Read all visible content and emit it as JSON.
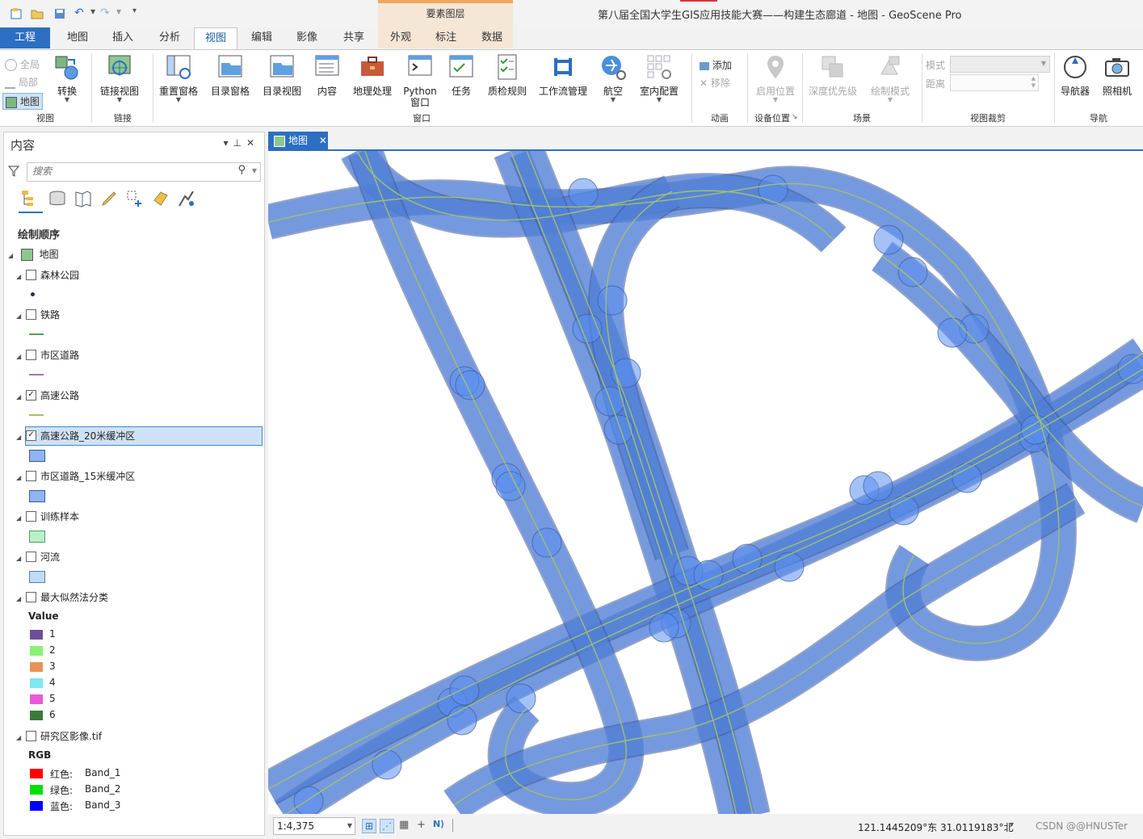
{
  "app": {
    "title": "第八届全国大学生GIS应用技能大赛——构建生态廊道 - 地图 - GeoScene Pro",
    "context_group": "要素图层"
  },
  "tabs": [
    {
      "label": "工程"
    },
    {
      "label": "地图"
    },
    {
      "label": "插入"
    },
    {
      "label": "分析"
    },
    {
      "label": "视图",
      "active": true
    },
    {
      "label": "编辑"
    },
    {
      "label": "影像"
    },
    {
      "label": "共享"
    },
    {
      "label": "外观"
    },
    {
      "label": "标注"
    },
    {
      "label": "数据"
    }
  ],
  "ribbon": {
    "view_group": {
      "label": "视图",
      "global": "全局",
      "local": "局部",
      "map": "地图",
      "convert": "转换"
    },
    "link_group": {
      "label": "链接",
      "link_views": "链接视图"
    },
    "window_group": {
      "label": "窗口",
      "buttons": [
        "重置窗格",
        "目录窗格",
        "目录视图",
        "内容",
        "地理处理",
        "Python 窗口",
        "任务",
        "质检规则",
        "工作流管理",
        "航空",
        "室内配置"
      ]
    },
    "python_line1": "Python",
    "python_line2": "窗口",
    "animation_group": {
      "label": "动画",
      "add": "添加",
      "remove": "移除"
    },
    "device_group": {
      "label": "设备位置",
      "enable": "启用位置"
    },
    "scene_group": {
      "label": "场景",
      "depth": "深度优先级",
      "draw_mode": "绘制模式"
    },
    "clip_group": {
      "label": "视图裁剪",
      "mode": "模式",
      "distance": "距离"
    },
    "nav_group": {
      "label": "导航",
      "navigator": "导航器",
      "camera": "照相机"
    }
  },
  "contents": {
    "title": "内容",
    "search_placeholder": "搜索",
    "drawing_order": "绘制顺序",
    "map_name": "地图",
    "layers": [
      {
        "name": "森林公园",
        "checked": false
      },
      {
        "name": "铁路",
        "checked": false
      },
      {
        "name": "市区道路",
        "checked": false
      },
      {
        "name": "高速公路",
        "checked": true
      },
      {
        "name": "高速公路_20米缓冲区",
        "checked": true,
        "selected": true
      },
      {
        "name": "市区道路_15米缓冲区",
        "checked": false
      },
      {
        "name": "训练样本",
        "checked": false
      },
      {
        "name": "河流",
        "checked": false
      },
      {
        "name": "最大似然法分类",
        "checked": false
      },
      {
        "name": "研究区影像.tif",
        "checked": false
      }
    ],
    "classification": {
      "field": "Value",
      "classes": [
        {
          "label": "1",
          "color": "#6b4f9a"
        },
        {
          "label": "2",
          "color": "#8af07a"
        },
        {
          "label": "3",
          "color": "#e8925a"
        },
        {
          "label": "4",
          "color": "#7ee8ec"
        },
        {
          "label": "5",
          "color": "#e85ad8"
        },
        {
          "label": "6",
          "color": "#3a7a3a"
        }
      ]
    },
    "rgb": {
      "title": "RGB",
      "bands": [
        {
          "channel": "红色:",
          "band": "Band_1",
          "color": "#ff0000"
        },
        {
          "channel": "绿色:",
          "band": "Band_2",
          "color": "#00e000"
        },
        {
          "channel": "蓝色:",
          "band": "Band_3",
          "color": "#0000ff"
        }
      ]
    }
  },
  "map": {
    "tab_label": "地图",
    "scale": "1:4,375",
    "coordinates": "121.1445209°东 31.0119183°北",
    "watermark": "CSDN @@HNUSTer"
  },
  "colors": {
    "accent": "#2c6fc2",
    "buffer_fill": "#5b8ff0",
    "buffer_stroke": "#3c5a9a",
    "highway_line": "#9fc070"
  }
}
